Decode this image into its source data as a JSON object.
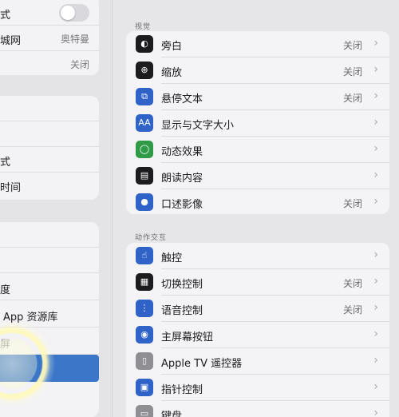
{
  "sidebar": {
    "top_rows": [
      {
        "label": "式",
        "value": "",
        "toggle": true
      },
      {
        "label": "城网",
        "value": "奥特曼"
      },
      {
        "label": "",
        "value": "关闭"
      }
    ],
    "mid_rows": [
      {
        "label": "式"
      },
      {
        "label": "时间"
      }
    ],
    "low_rows": [
      {
        "label": "度"
      },
      {
        "label": "App 资源库"
      },
      {
        "label": "屏"
      }
    ]
  },
  "vision": {
    "title": "视觉",
    "items": [
      {
        "label": "旁白",
        "value": "关闭",
        "icon": "voiceover-icon",
        "color": "#1c1c1e"
      },
      {
        "label": "缩放",
        "value": "关闭",
        "icon": "zoom-icon",
        "color": "#1c1c1e"
      },
      {
        "label": "悬停文本",
        "value": "关闭",
        "icon": "hover-text-icon",
        "color": "#2f63c8"
      },
      {
        "label": "显示与文字大小",
        "value": "",
        "icon": "text-size-icon",
        "color": "#2f63c8"
      },
      {
        "label": "动态效果",
        "value": "",
        "icon": "motion-icon",
        "color": "#2f9b47"
      },
      {
        "label": "朗读内容",
        "value": "",
        "icon": "spoken-content-icon",
        "color": "#1c1c1e"
      },
      {
        "label": "口述影像",
        "value": "关闭",
        "icon": "audio-description-icon",
        "color": "#2f63c8"
      }
    ]
  },
  "interaction": {
    "title": "动作交互",
    "items": [
      {
        "label": "触控",
        "value": "",
        "icon": "touch-icon",
        "color": "#2f63c8"
      },
      {
        "label": "切换控制",
        "value": "关闭",
        "icon": "switch-control-icon",
        "color": "#1c1c1e"
      },
      {
        "label": "语音控制",
        "value": "关闭",
        "icon": "voice-control-icon",
        "color": "#2f63c8"
      },
      {
        "label": "主屏幕按钮",
        "value": "",
        "icon": "home-button-icon",
        "color": "#2f63c8"
      },
      {
        "label": "Apple TV 遥控器",
        "value": "",
        "icon": "apple-tv-remote-icon",
        "color": "#8e8e93"
      },
      {
        "label": "指针控制",
        "value": "",
        "icon": "pointer-control-icon",
        "color": "#2f63c8"
      },
      {
        "label": "键盘",
        "value": "",
        "icon": "keyboard-icon",
        "color": "#8e8e93"
      }
    ]
  },
  "chevron": "›"
}
